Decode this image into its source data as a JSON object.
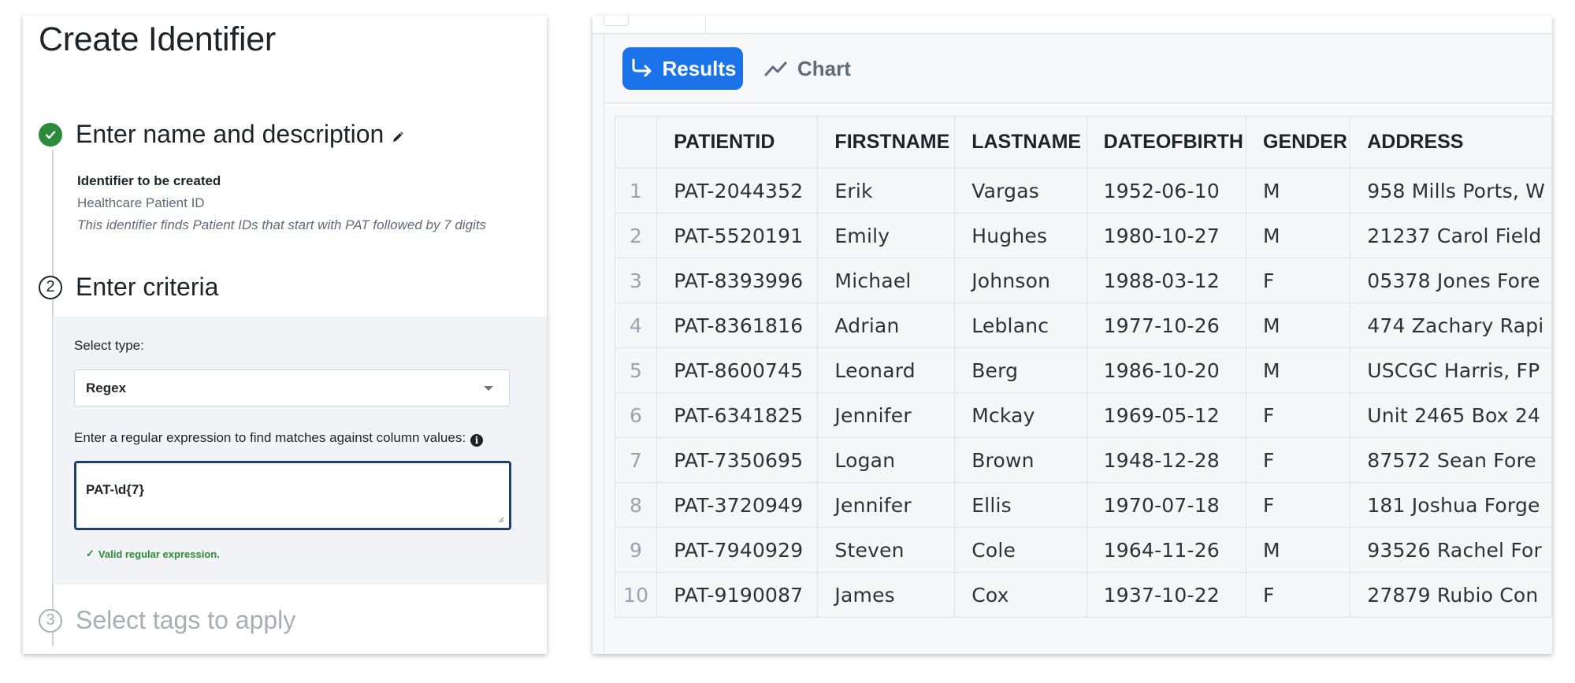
{
  "left": {
    "title": "Create Identifier",
    "steps": [
      {
        "number": "✓",
        "title": "Enter name and description",
        "state": "done"
      },
      {
        "number": "2",
        "title": "Enter criteria",
        "state": "active"
      },
      {
        "number": "3",
        "title": "Select tags to apply",
        "state": "future"
      }
    ],
    "summary": {
      "label": "Identifier to be created",
      "name": "Healthcare Patient ID",
      "description": "This identifier finds Patient IDs that start with PAT followed by 7 digits"
    },
    "criteria": {
      "select_type_label": "Select type:",
      "select_type_value": "Regex",
      "regex_label": "Enter a regular expression to find matches against column values:",
      "regex_value": "PAT-\\d{7}",
      "valid_message": "Valid regular expression."
    }
  },
  "right": {
    "tabs": [
      {
        "label": "Results",
        "active": true,
        "icon": "arrow-turn-icon"
      },
      {
        "label": "Chart",
        "active": false,
        "icon": "line-chart-icon"
      }
    ],
    "columns": [
      "PATIENTID",
      "FIRSTNAME",
      "LASTNAME",
      "DATEOFBIRTH",
      "GENDER",
      "ADDRESS"
    ],
    "rows": [
      [
        "1",
        "PAT-2044352",
        "Erik",
        "Vargas",
        "1952-06-10",
        "M",
        "958 Mills Ports, W"
      ],
      [
        "2",
        "PAT-5520191",
        "Emily",
        "Hughes",
        "1980-10-27",
        "M",
        "21237 Carol Field"
      ],
      [
        "3",
        "PAT-8393996",
        "Michael",
        "Johnson",
        "1988-03-12",
        "F",
        "05378 Jones Fore"
      ],
      [
        "4",
        "PAT-8361816",
        "Adrian",
        "Leblanc",
        "1977-10-26",
        "M",
        "474 Zachary Rapi"
      ],
      [
        "5",
        "PAT-8600745",
        "Leonard",
        "Berg",
        "1986-10-20",
        "M",
        "USCGC Harris, FP"
      ],
      [
        "6",
        "PAT-6341825",
        "Jennifer",
        "Mckay",
        "1969-05-12",
        "F",
        "Unit 2465 Box 24"
      ],
      [
        "7",
        "PAT-7350695",
        "Logan",
        "Brown",
        "1948-12-28",
        "F",
        "87572 Sean Fore"
      ],
      [
        "8",
        "PAT-3720949",
        "Jennifer",
        "Ellis",
        "1970-07-18",
        "F",
        "181 Joshua Forge"
      ],
      [
        "9",
        "PAT-7940929",
        "Steven",
        "Cole",
        "1964-11-26",
        "M",
        "93526 Rachel For"
      ],
      [
        "10",
        "PAT-9190087",
        "James",
        "Cox",
        "1937-10-22",
        "F",
        "27879 Rubio Con"
      ]
    ]
  },
  "colors": {
    "accent": "#1a73e8",
    "success": "#2c8a3a",
    "focus_border": "#1c3f6b"
  }
}
